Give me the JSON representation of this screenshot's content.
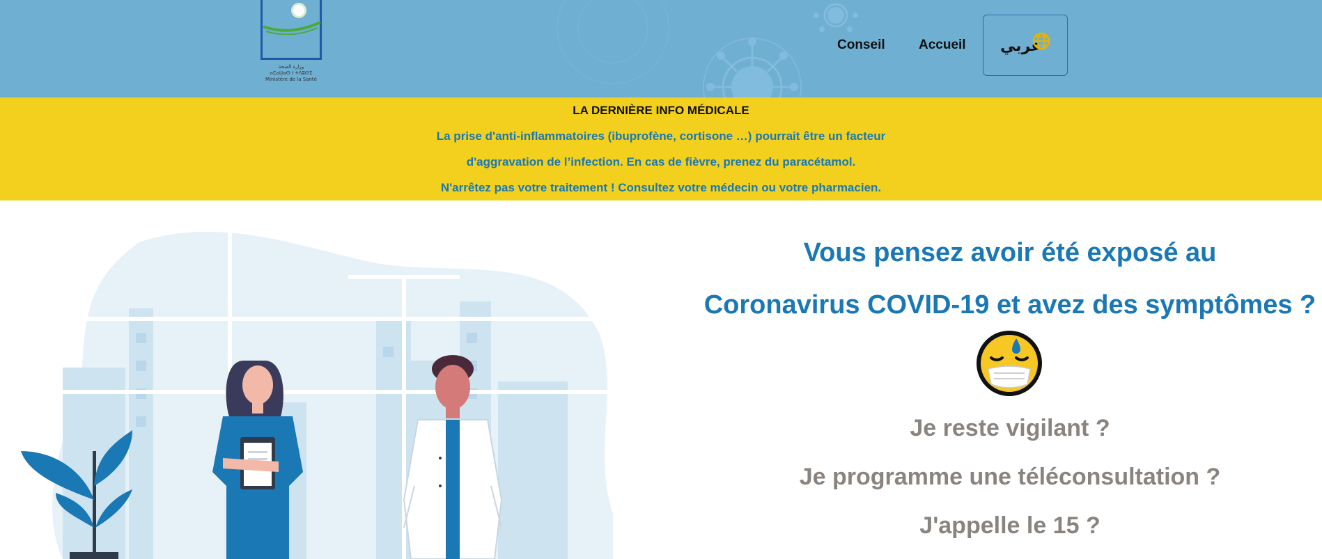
{
  "header": {
    "logo": {
      "text_lines": [
        "وزارة الصحة",
        "ⴰⵎⴰⵡⴰⵙ ⵏ ⵜⴷⵓⵙⵉ",
        "Ministère de la Santé"
      ]
    },
    "nav": {
      "conseil_label": "Conseil",
      "accueil_label": "Accueil",
      "lang_label": "عربي",
      "lang_icon": "globe-icon"
    }
  },
  "banner": {
    "title": "LA DERNIÈRE INFO MÉDICALE",
    "lines": [
      "La prise d'anti-inflammatoires (ibuprofène, cortisone …) pourrait être un facteur",
      "d'aggravation de l’infection. En cas de fièvre, prenez du paracétamol.",
      "N'arrêtez pas votre traitement ! Consultez votre médecin ou votre pharmacien."
    ]
  },
  "main": {
    "headline": [
      "Vous pensez avoir été exposé au",
      "Coronavirus COVID-19 et avez des symptômes ?"
    ],
    "emoji": "masked-face-icon",
    "questions": [
      "Je reste vigilant ?",
      "Je programme une téléconsultation ?",
      "J'appelle le 15 ?"
    ]
  },
  "colors": {
    "header_bg": "#6fafd2",
    "banner_bg": "#f3d01d",
    "accent_blue": "#1a78b4",
    "question_gray": "#8a8480"
  }
}
